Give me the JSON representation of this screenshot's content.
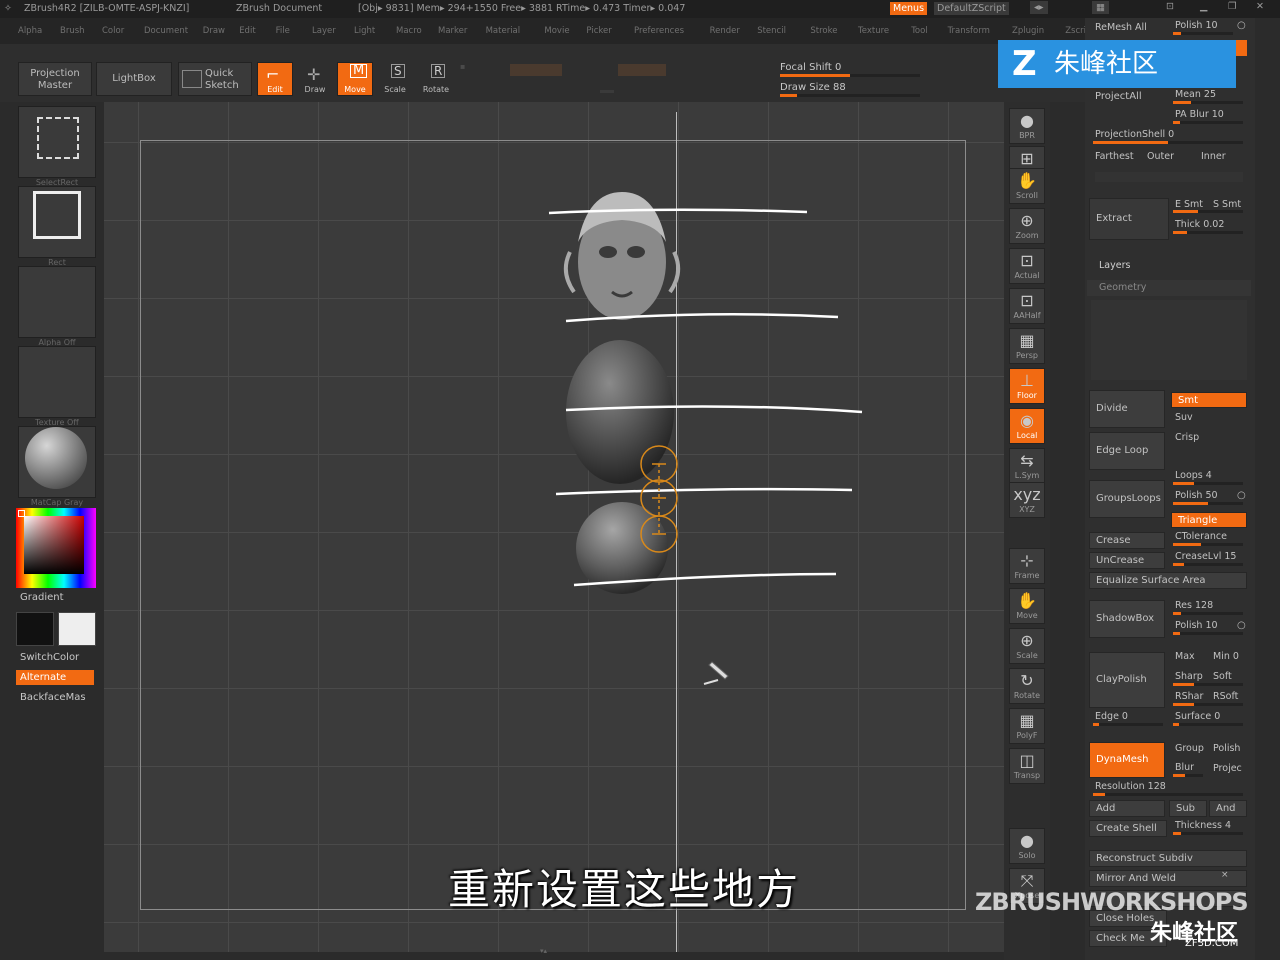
{
  "titlebar": {
    "app": "ZBrush4R2 [ZILB-OMTE-ASPJ-KNZI]",
    "doc": "ZBrush Document",
    "stats": "[Obj▸ 9831] Mem▸ 294+1550 Free▸ 3881 RTime▸ 0.473 Timer▸ 0.047",
    "menus_btn": "Menus",
    "script": "DefaultZScript"
  },
  "menubar": [
    "Alpha",
    "Brush",
    "Color",
    "Document",
    "Draw",
    "Edit",
    "File",
    "Layer",
    "Light",
    "Macro",
    "Marker",
    "Material",
    "Movie",
    "Picker",
    "Preferences",
    "Render",
    "Stencil",
    "Stroke",
    "Texture",
    "Tool",
    "Transform",
    "Zplugin",
    "Zscript"
  ],
  "toolbar": {
    "projection_master": "Projection Master",
    "lightbox": "LightBox",
    "quick_sketch": "Quick Sketch",
    "edit": "Edit",
    "draw": "Draw",
    "move": "Move",
    "scale": "Scale",
    "rotate": "Rotate",
    "focal_shift": "Focal Shift 0",
    "draw_size": "Draw Size 88",
    "focal_shift_level": 0.5,
    "draw_size_level": 0.12
  },
  "leftpanel": {
    "select_rect": "SelectRect",
    "rect": "Rect",
    "alpha_off": "Alpha Off",
    "texture_off": "Texture Off",
    "matcap": "MatCap Gray",
    "gradient": "Gradient",
    "switch_color": "SwitchColor",
    "alternate": "Alternate",
    "backface": "BackfaceMas"
  },
  "shelf": [
    "BPR",
    "SPix",
    "Scroll",
    "Zoom",
    "Actual",
    "AAHalf",
    "Persp",
    "Floor",
    "Local",
    "L.Sym",
    "XYZ",
    "Frame",
    "Move",
    "Scale",
    "Rotate",
    "PolyF",
    "Transp",
    "Solo",
    "Xpose"
  ],
  "shelf_icons": [
    "sphere-icon",
    "spix-icon",
    "scroll-icon",
    "zoom-icon",
    "actual-icon",
    "aahalf-icon",
    "persp-icon",
    "floor-icon",
    "local-icon",
    "lsym-icon",
    "xyz-icon",
    "frame-icon",
    "move-icon",
    "scale-icon",
    "rotate-icon",
    "polyf-icon",
    "transp-icon",
    "solo-icon",
    "xpose-icon"
  ],
  "rightpanel": {
    "remesh_all": "ReMesh All",
    "polish": "Polish 10",
    "project_all": "ProjectAll",
    "mean": "Mean 25",
    "pa_blur": "PA Blur 10",
    "projection_shell": "ProjectionShell 0",
    "farthest": "Farthest",
    "outer": "Outer",
    "inner": "Inner",
    "extract": "Extract",
    "e_smt": "E Smt",
    "s_smt": "S Smt",
    "thick": "Thick 0.02",
    "layers": "Layers",
    "geometry": "Geometry",
    "divide": "Divide",
    "smt": "Smt",
    "suv": "Suv",
    "edge_loop": "Edge Loop",
    "crisp": "Crisp",
    "groups_loops": "GroupsLoops",
    "loops": "Loops 4",
    "polish50": "Polish 50",
    "triangle": "Triangle",
    "crease": "Crease",
    "ctolerance": "CTolerance",
    "uncrease": "UnCrease",
    "creaselvl": "CreaseLvl 15",
    "equalize": "Equalize Surface Area",
    "shadowbox": "ShadowBox",
    "res128": "Res 128",
    "polish10b": "Polish 10",
    "claypolish": "ClayPolish",
    "max": "Max",
    "min": "Min 0",
    "sharp": "Sharp",
    "soft": "Soft",
    "rsharp": "RShar",
    "rsoft": "RSoft",
    "edge0": "Edge 0",
    "surface0": "Surface 0",
    "dynamesh": "DynaMesh",
    "group": "Group",
    "polish2": "Polish",
    "blur": "Blur",
    "project": "Projec",
    "resolution": "Resolution 128",
    "add": "Add",
    "sub": "Sub",
    "and": "And",
    "create_shell": "Create Shell",
    "thickness": "Thickness 4",
    "reconstruct": "Reconstruct Subdiv",
    "mirror_weld": "Mirror And Weld",
    "close_holes": "Close Holes",
    "check_mesh": "Check Me"
  },
  "subtitle": "重新设置这些地方",
  "watermark": {
    "logo": "朱峰社区",
    "workshops": "ZBRUSHWORKSHOPS",
    "corner": "朱峰社区",
    "corner_url": "ZF3D.COM"
  }
}
